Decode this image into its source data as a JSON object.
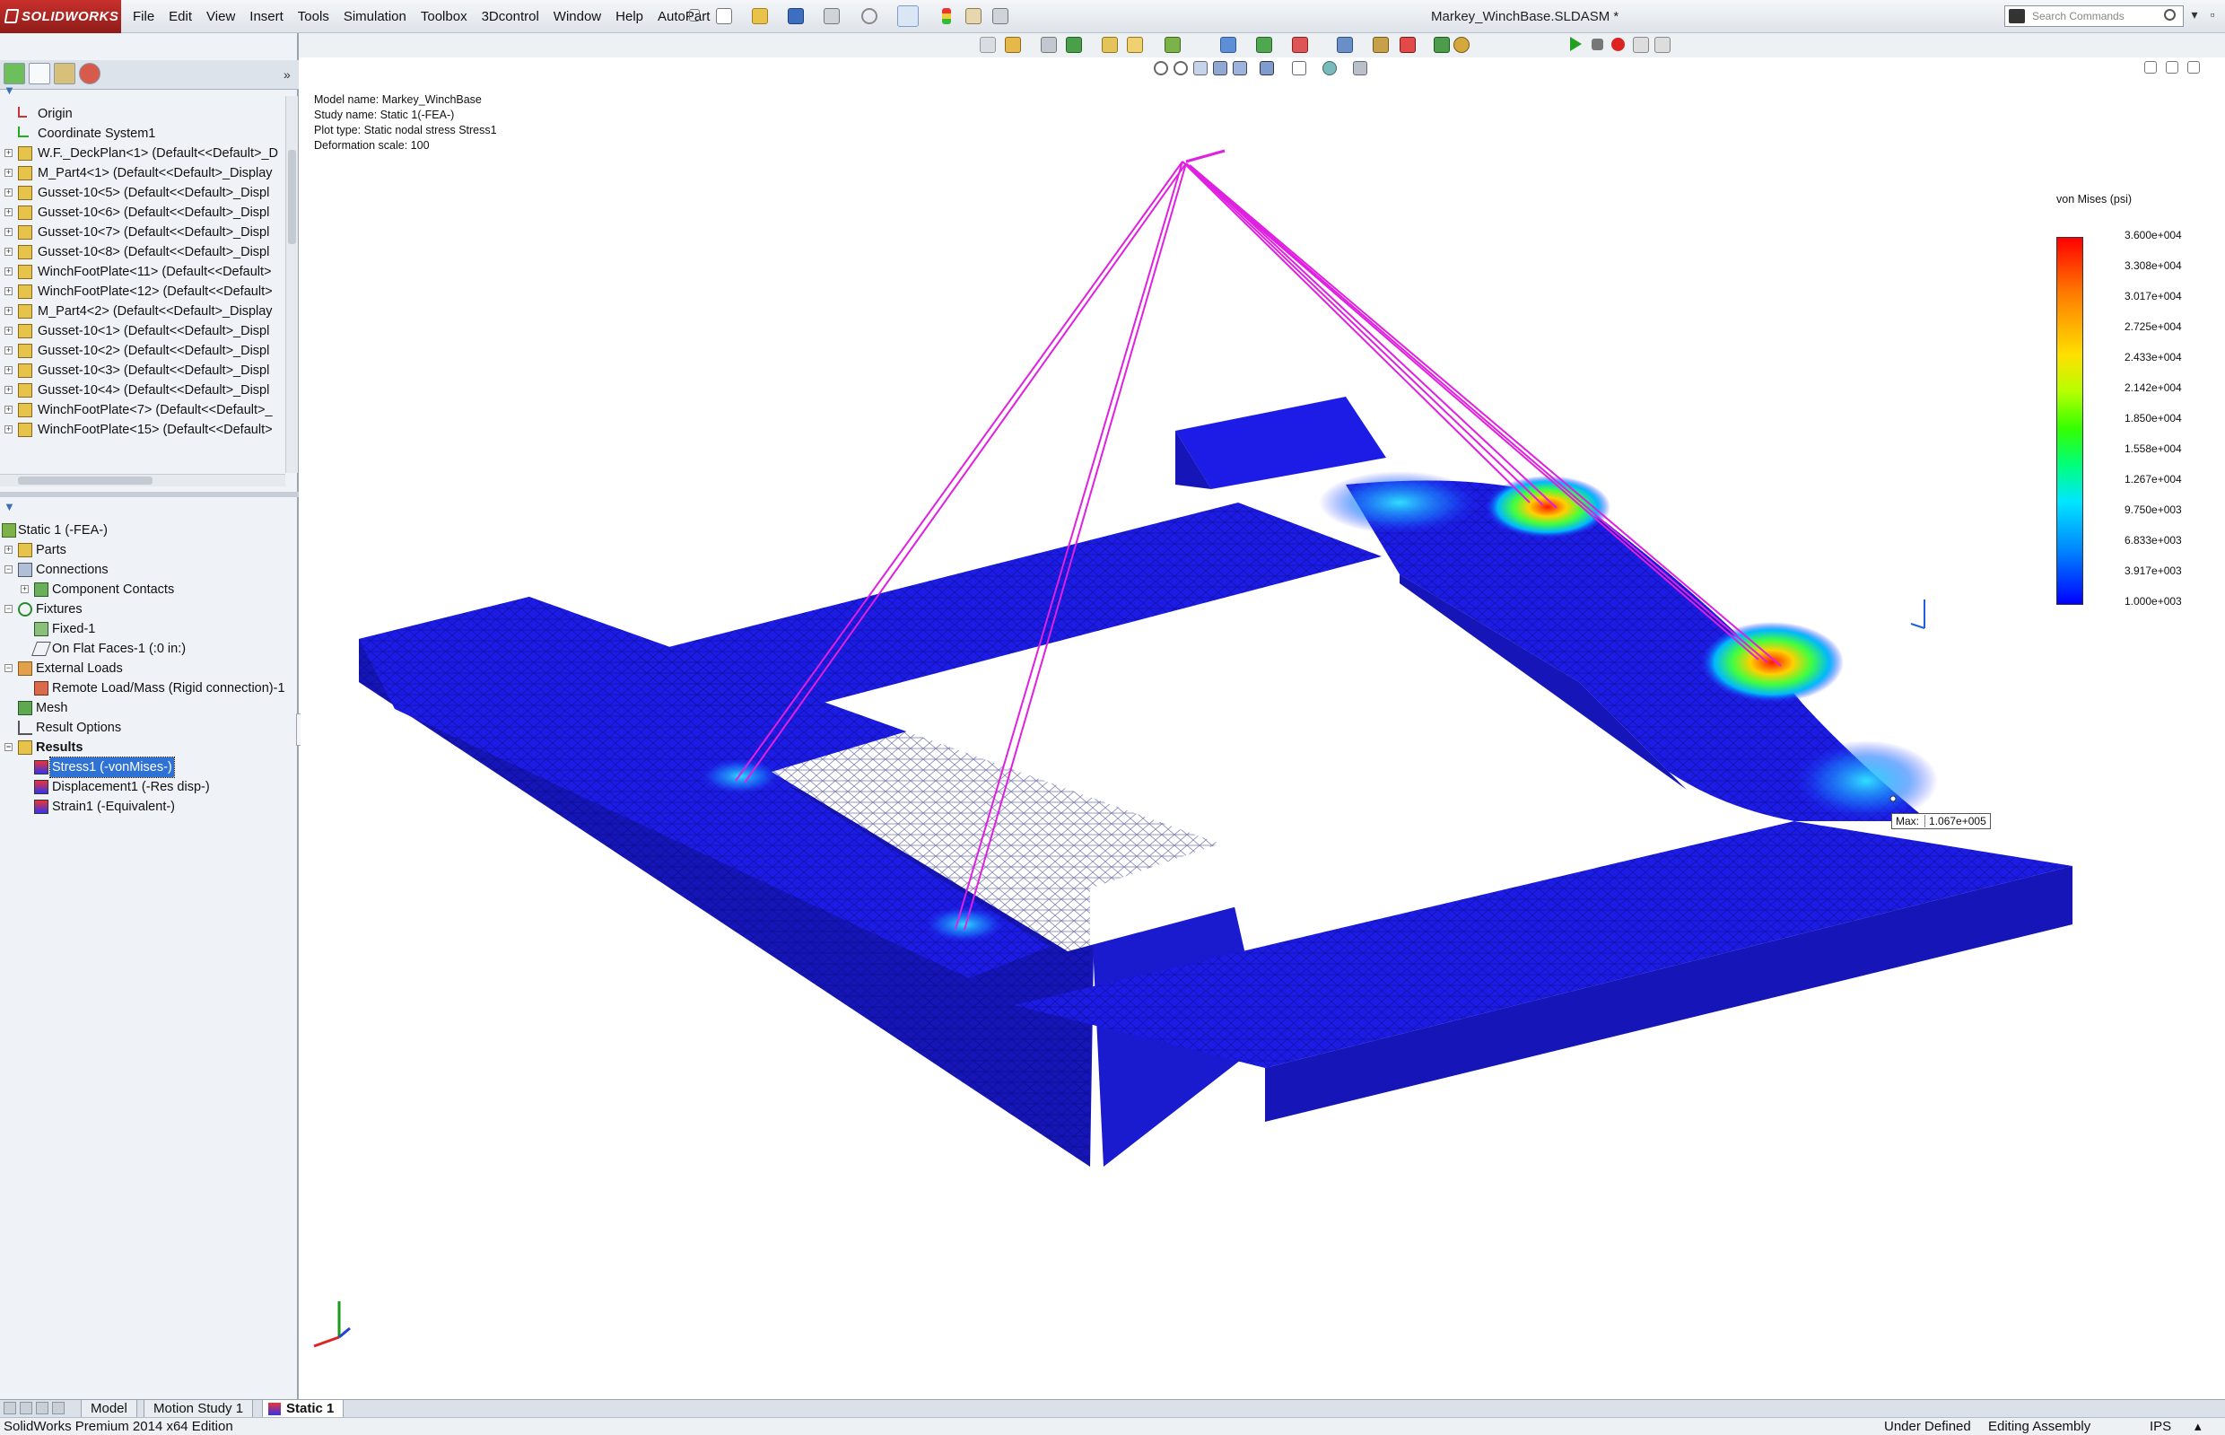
{
  "app": {
    "logo_text": "SOLIDWORKS",
    "menus": [
      "File",
      "Edit",
      "View",
      "Insert",
      "Tools",
      "Simulation",
      "Toolbox",
      "3Dcontrol",
      "Window",
      "Help",
      "AutoPart"
    ],
    "document_title": "Markey_WinchBase.SLDASM *",
    "search_placeholder": "Search Commands"
  },
  "feature_tree": {
    "items": [
      {
        "label": "Origin",
        "icon": "origin-icon"
      },
      {
        "label": "Coordinate System1",
        "icon": "coordinate-system-icon"
      },
      {
        "label": "W.F._DeckPlan<1> (Default<<Default>_D",
        "icon": "part-icon"
      },
      {
        "label": "M_Part4<1> (Default<<Default>_Display",
        "icon": "part-icon"
      },
      {
        "label": "Gusset-10<5> (Default<<Default>_Displ",
        "icon": "part-icon"
      },
      {
        "label": "Gusset-10<6> (Default<<Default>_Displ",
        "icon": "part-icon"
      },
      {
        "label": "Gusset-10<7> (Default<<Default>_Displ",
        "icon": "part-icon"
      },
      {
        "label": "Gusset-10<8> (Default<<Default>_Displ",
        "icon": "part-icon"
      },
      {
        "label": "WinchFootPlate<11> (Default<<Default>",
        "icon": "part-icon"
      },
      {
        "label": "WinchFootPlate<12> (Default<<Default>",
        "icon": "part-icon"
      },
      {
        "label": "M_Part4<2> (Default<<Default>_Display",
        "icon": "part-icon"
      },
      {
        "label": "Gusset-10<1> (Default<<Default>_Displ",
        "icon": "part-icon"
      },
      {
        "label": "Gusset-10<2> (Default<<Default>_Displ",
        "icon": "part-icon"
      },
      {
        "label": "Gusset-10<3> (Default<<Default>_Displ",
        "icon": "part-icon"
      },
      {
        "label": "Gusset-10<4> (Default<<Default>_Displ",
        "icon": "part-icon"
      },
      {
        "label": "WinchFootPlate<7> (Default<<Default>_",
        "icon": "part-icon"
      },
      {
        "label": "WinchFootPlate<15> (Default<<Default>",
        "icon": "part-icon"
      }
    ]
  },
  "study_tree": {
    "study": "Static 1 (-FEA-)",
    "parts": "Parts",
    "connections": "Connections",
    "component_contacts": "Component Contacts",
    "fixtures": "Fixtures",
    "fixed": "Fixed-1",
    "on_flat_faces": "On Flat Faces-1 (:0 in:)",
    "external_loads": "External Loads",
    "remote_load": "Remote Load/Mass (Rigid connection)-1",
    "mesh": "Mesh",
    "result_options": "Result Options",
    "results": "Results",
    "stress": "Stress1 (-vonMises-)",
    "displacement": "Displacement1 (-Res disp-)",
    "strain": "Strain1 (-Equivalent-)"
  },
  "study_info": {
    "model_name": "Model name: Markey_WinchBase",
    "study_name": "Study name: Static 1(-FEA-)",
    "plot_type": "Plot type: Static nodal stress Stress1",
    "deformation_scale": "Deformation scale: 100"
  },
  "legend": {
    "title": "von Mises (psi)",
    "ticks": [
      "3.600e+004",
      "3.308e+004",
      "3.017e+004",
      "2.725e+004",
      "2.433e+004",
      "2.142e+004",
      "1.850e+004",
      "1.558e+004",
      "1.267e+004",
      "9.750e+003",
      "6.833e+003",
      "3.917e+003",
      "1.000e+003"
    ]
  },
  "max_probe": {
    "label": "Max:",
    "value": "1.067e+005"
  },
  "bottom_tabs": [
    "Model",
    "Motion Study 1",
    "Static 1"
  ],
  "status": {
    "edition": "SolidWorks Premium 2014 x64 Edition",
    "state": "Under Defined",
    "mode": "Editing Assembly",
    "units": "IPS"
  },
  "colors": {
    "stress_low": "#1010e0",
    "stress_high": "#ff0000",
    "load_lines": "#e020e0",
    "selection": "#2f72d6"
  }
}
